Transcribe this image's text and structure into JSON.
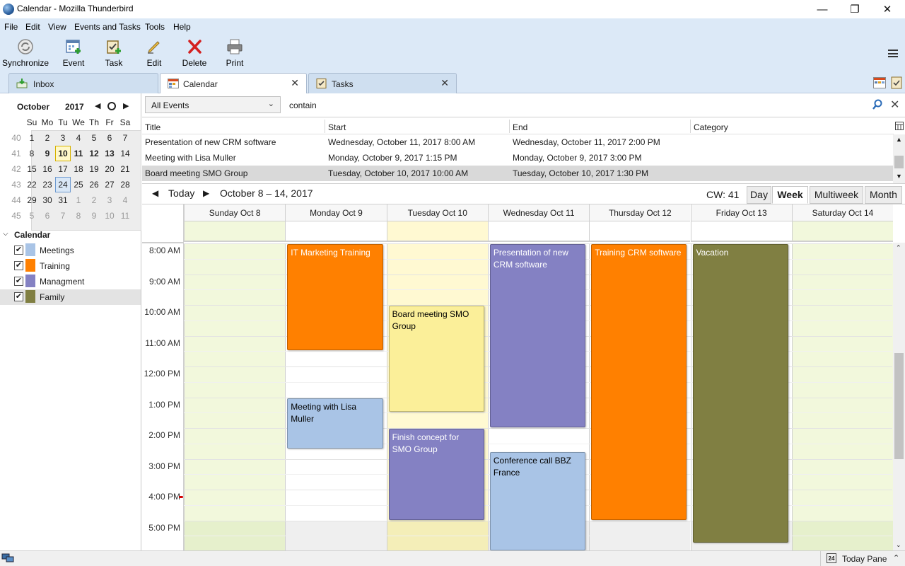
{
  "window": {
    "title": "Calendar - Mozilla Thunderbird"
  },
  "menu": [
    "File",
    "Edit",
    "View",
    "Events and Tasks",
    "Tools",
    "Help"
  ],
  "toolbar": {
    "synchronize": "Synchronize",
    "event": "Event",
    "task": "Task",
    "edit": "Edit",
    "delete": "Delete",
    "print": "Print"
  },
  "tabs": [
    {
      "label": "Inbox"
    },
    {
      "label": "Calendar"
    },
    {
      "label": "Tasks"
    }
  ],
  "minical": {
    "month": "October",
    "year": "2017",
    "dow": [
      "Su",
      "Mo",
      "Tu",
      "We",
      "Th",
      "Fr",
      "Sa"
    ],
    "weeks": [
      {
        "wk": "40",
        "days": [
          "1",
          "2",
          "3",
          "4",
          "5",
          "6",
          "7"
        ]
      },
      {
        "wk": "41",
        "days": [
          "8",
          "9",
          "10",
          "11",
          "12",
          "13",
          "14"
        ]
      },
      {
        "wk": "42",
        "days": [
          "15",
          "16",
          "17",
          "18",
          "19",
          "20",
          "21"
        ]
      },
      {
        "wk": "43",
        "days": [
          "22",
          "23",
          "24",
          "25",
          "26",
          "27",
          "28"
        ]
      },
      {
        "wk": "44",
        "days": [
          "29",
          "30",
          "31",
          "1",
          "2",
          "3",
          "4"
        ]
      },
      {
        "wk": "45",
        "days": [
          "5",
          "6",
          "7",
          "8",
          "9",
          "10",
          "11"
        ]
      }
    ]
  },
  "calendars": {
    "heading": "Calendar",
    "items": [
      {
        "name": "Meetings",
        "color": "#a9c4e6"
      },
      {
        "name": "Training",
        "color": "#ff8000"
      },
      {
        "name": "Managment",
        "color": "#8481c3"
      },
      {
        "name": "Family",
        "color": "#807f42"
      }
    ]
  },
  "filter": {
    "select": "All Events",
    "contain_label": "contain",
    "search_value": ""
  },
  "event_list": {
    "columns": [
      "Title",
      "Start",
      "End",
      "Category"
    ],
    "rows": [
      {
        "title": "Presentation of new CRM software",
        "start": "Wednesday, October 11, 2017 8:00 AM",
        "end": "Wednesday, October 11, 2017 2:00 PM",
        "category": ""
      },
      {
        "title": "Meeting with Lisa Muller",
        "start": "Monday, October 9, 2017 1:15 PM",
        "end": "Monday, October 9, 2017 3:00 PM",
        "category": ""
      },
      {
        "title": "Board meeting SMO Group",
        "start": "Tuesday, October 10, 2017 10:00 AM",
        "end": "Tuesday, October 10, 2017 1:30 PM",
        "category": ""
      }
    ]
  },
  "view": {
    "today": "Today",
    "range": "October 8 – 14, 2017",
    "cw": "CW: 41",
    "modes": [
      "Day",
      "Week",
      "Multiweek",
      "Month"
    ],
    "active_mode": "Week"
  },
  "week": {
    "days": [
      "Sunday Oct 8",
      "Monday Oct 9",
      "Tuesday Oct 10",
      "Wednesday Oct 11",
      "Thursday Oct 12",
      "Friday Oct 13",
      "Saturday Oct 14"
    ],
    "hours": [
      "8:00 AM",
      "9:00 AM",
      "10:00 AM",
      "11:00 AM",
      "12:00 PM",
      "1:00 PM",
      "2:00 PM",
      "3:00 PM",
      "4:00 PM",
      "5:00 PM"
    ],
    "events": [
      {
        "title": "IT Marketing Training",
        "day": 1,
        "start": 8.0,
        "end": 11.5,
        "color": "#ff8000",
        "text_color": "#ffffff"
      },
      {
        "title": "Meeting with Lisa Muller",
        "day": 1,
        "start": 13.0,
        "end": 14.7,
        "color": "#a9c4e6",
        "text_color": "#000000"
      },
      {
        "title": "Board meeting SMO Group",
        "day": 2,
        "start": 10.0,
        "end": 13.5,
        "color": "#fbef99",
        "text_color": "#000000"
      },
      {
        "title": "Finish concept for SMO Group",
        "day": 2,
        "start": 14.0,
        "end": 17.0,
        "color": "#8481c3",
        "text_color": "#ffffff"
      },
      {
        "title": "Presentation of new CRM software",
        "day": 3,
        "start": 8.0,
        "end": 14.0,
        "color": "#8481c3",
        "text_color": "#ffffff"
      },
      {
        "title": "Conference call BBZ France",
        "day": 3,
        "start": 14.75,
        "end": 18.0,
        "color": "#a9c4e6",
        "text_color": "#000000"
      },
      {
        "title": "Training CRM software",
        "day": 4,
        "start": 8.0,
        "end": 17.0,
        "color": "#ff8000",
        "text_color": "#ffffff"
      },
      {
        "title": "Vacation",
        "day": 5,
        "start": 8.0,
        "end": 17.75,
        "color": "#807f42",
        "text_color": "#ffffff"
      }
    ]
  },
  "statusbar": {
    "today_pane": "Today Pane",
    "today_icon_day": "24"
  }
}
